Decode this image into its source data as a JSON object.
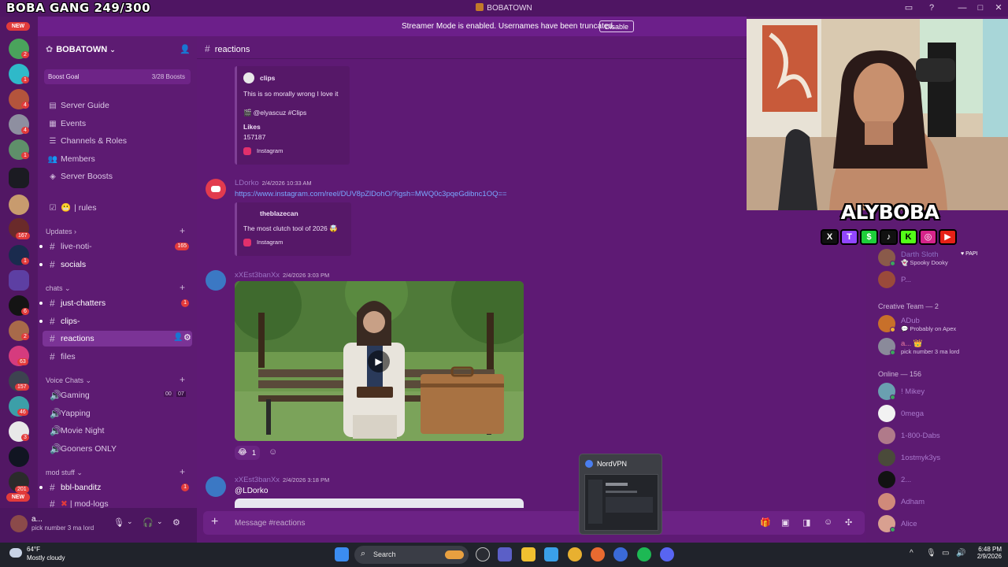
{
  "overlay": {
    "goal_text": "BOBA GANG 249/300",
    "logo_name": "ALYBOBA",
    "socials": [
      "X",
      "T",
      "$",
      "♪",
      "K",
      "◎",
      "▶"
    ]
  },
  "window": {
    "title": "BOBATOWN"
  },
  "banner": {
    "text": "Streamer Mode is enabled. Usernames have been truncated.",
    "disable_label": "Disable"
  },
  "rail": {
    "new_top": "NEW",
    "new_bottom": "NEW",
    "badges": [
      "2",
      "1",
      "4",
      "4",
      "1",
      "167",
      "1",
      "6",
      "2",
      "63",
      "157",
      "46",
      "3",
      "201"
    ]
  },
  "sidebar": {
    "server_name": "BOBATOWN",
    "boost_goal_label": "Boost Goal",
    "boost_goal_value": "3/28 Boosts",
    "nav": [
      {
        "label": "Server Guide"
      },
      {
        "label": "Events"
      },
      {
        "label": "Channels & Roles"
      },
      {
        "label": "Members"
      },
      {
        "label": "Server Boosts"
      }
    ],
    "rules_label": "| rules",
    "categories": {
      "updates": "Updates",
      "chats": "chats",
      "voice": "Voice Chats",
      "mod": "mod stuff"
    },
    "channels": {
      "live_noti": {
        "name": "live-noti-",
        "count": "165"
      },
      "socials": {
        "name": "socials"
      },
      "just_chatters": {
        "name": "just-chatters",
        "count": "1"
      },
      "clips": {
        "name": "clips-"
      },
      "reactions": {
        "name": "reactions"
      },
      "files": {
        "name": "files"
      },
      "bbl": {
        "name": "bbl-banditz",
        "count": "1"
      },
      "mod_logs": {
        "name": "| mod-logs"
      }
    },
    "voice": [
      {
        "name": "Gaming",
        "a": "00",
        "b": "07"
      },
      {
        "name": "Yapping"
      },
      {
        "name": "Movie Night"
      },
      {
        "name": "Gooners ONLY"
      }
    ]
  },
  "user": {
    "name": "a...",
    "status": "pick number 3 ma lord"
  },
  "chat": {
    "channel": "reactions",
    "composer_placeholder": "Message #reactions",
    "embed1": {
      "author": "clips",
      "desc": "This is so morally wrong I love it",
      "tag": "@elyascuz #Clips",
      "likes_label": "Likes",
      "likes_value": "157187",
      "provider": "Instagram"
    },
    "msg2": {
      "author": "LDorko",
      "time": "2/4/2026 10:33 AM",
      "link": "https://www.instagram.com/reel/DUV8pZlDohO/?igsh=MWQ0c3pqeGdibnc1OQ==",
      "embed_author": "theblazecan",
      "embed_desc": "The most clutch tool of 2026 🤯",
      "embed_provider": "Instagram"
    },
    "msg3": {
      "author": "xXEst3banXx",
      "time": "2/4/2026 3:03 PM",
      "reaction_count": "1"
    },
    "msg4": {
      "author": "xXEst3banXx",
      "time": "2/4/2026 3:18 PM",
      "text": "@LDorko"
    }
  },
  "members": {
    "top": [
      {
        "name": "Darth Sloth",
        "status": "Spooky Dooky",
        "tag": "PAPI"
      },
      {
        "name": "P...",
        "status": ""
      }
    ],
    "creative_label": "Creative Team — 2",
    "creative": [
      {
        "name": "ADub",
        "status": "Probably on Apex"
      },
      {
        "name": "a...",
        "status": "pick number 3 ma lord"
      }
    ],
    "online_label": "Online — 156",
    "online": [
      {
        "name": "! Mikey"
      },
      {
        "name": "0mega"
      },
      {
        "name": "1-800-Dabs"
      },
      {
        "name": "1ostmyk3ys"
      },
      {
        "name": "2..."
      },
      {
        "name": "Adham"
      },
      {
        "name": "Alice"
      }
    ]
  },
  "nord": {
    "title": "NordVPN"
  },
  "taskbar": {
    "temp": "64°F",
    "weather": "Mostly cloudy",
    "search": "Search",
    "time": "6:48 PM",
    "date": "2/9/2026"
  }
}
